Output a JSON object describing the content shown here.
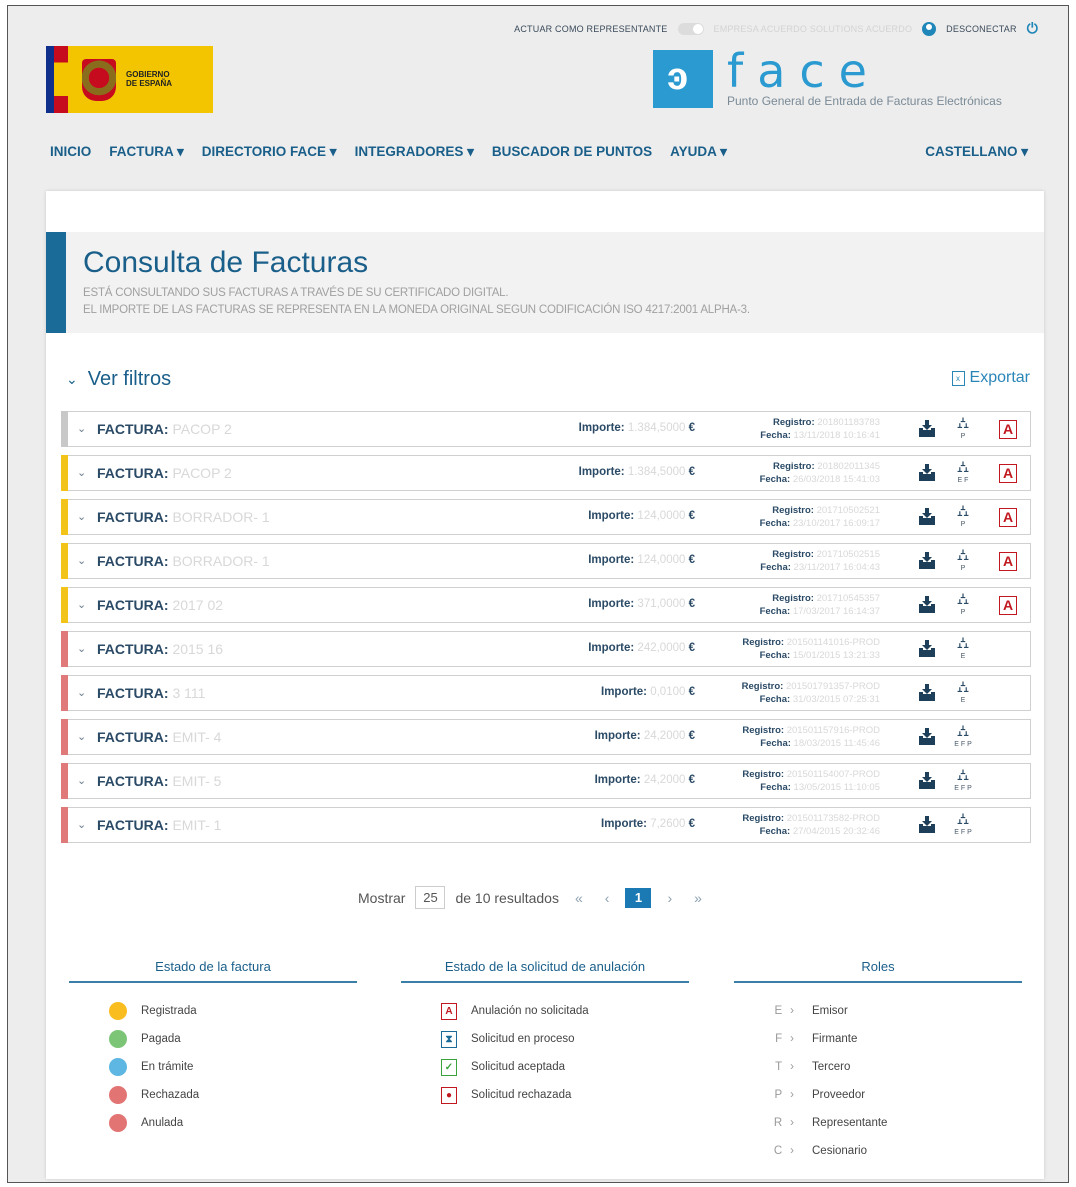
{
  "topbar": {
    "representante_label": "ACTUAR COMO REPRESENTANTE",
    "company_blurred": "EMPRESA ACUERDO SOLUTIONS ACUERDO",
    "disconnect_label": "DESCONECTAR"
  },
  "logos": {
    "gov_text_line1": "GOBIERNO",
    "gov_text_line2": "DE ESPAÑA",
    "face_letters": "face",
    "face_subtitle": "Punto General de Entrada de Facturas Electrónicas"
  },
  "nav": {
    "items": [
      "INICIO",
      "FACTURA ▾",
      "DIRECTORIO FACE ▾",
      "INTEGRADORES ▾",
      "BUSCADOR DE PUNTOS",
      "AYUDA ▾"
    ],
    "language": "CASTELLANO ▾"
  },
  "page": {
    "title": "Consulta de Facturas",
    "subtitle1": "ESTÁ CONSULTANDO SUS FACTURAS A TRAVÉS DE SU CERTIFICADO DIGITAL.",
    "subtitle2": "EL IMPORTE DE LAS FACTURAS SE REPRESENTA EN LA MONEDA ORIGINAL SEGUN CODIFICACIÓN ISO 4217:2001 ALPHA-3.",
    "filters_label": "Ver filtros",
    "export_label": "Exportar"
  },
  "labels": {
    "factura": "FACTURA:",
    "importe": "Importe:",
    "registro": "Registro:",
    "fecha": "Fecha:",
    "currency": "€"
  },
  "invoices": [
    {
      "numero": "PACOP 2",
      "importe": "1.384,5000",
      "registro": "201801183783",
      "fecha": "13/11/2018 10:16:41",
      "status_color": "#c8c8c8",
      "roles": "P",
      "pdf": true
    },
    {
      "numero": "PACOP 2",
      "importe": "1.384,5000",
      "registro": "201802011345",
      "fecha": "26/03/2018 15:41:03",
      "status_color": "#f2c318",
      "roles": "E F",
      "pdf": true
    },
    {
      "numero": "BORRADOR- 1",
      "importe": "124,0000",
      "registro": "201710502521",
      "fecha": "23/10/2017 16:09:17",
      "status_color": "#f2c318",
      "roles": "P",
      "pdf": true
    },
    {
      "numero": "BORRADOR- 1",
      "importe": "124,0000",
      "registro": "201710502515",
      "fecha": "23/11/2017 16:04:43",
      "status_color": "#f2c318",
      "roles": "P",
      "pdf": true
    },
    {
      "numero": "2017 02",
      "importe": "371,0000",
      "registro": "201710545357",
      "fecha": "17/03/2017 16:14:37",
      "status_color": "#f2c318",
      "roles": "P",
      "pdf": true
    },
    {
      "numero": "2015 16",
      "importe": "242,0000",
      "registro": "201501141016-PROD",
      "fecha": "15/01/2015 13:21:33",
      "status_color": "#e07a7a",
      "roles": "E",
      "pdf": false
    },
    {
      "numero": "3 111",
      "importe": "0,0100",
      "registro": "201501791357-PROD",
      "fecha": "31/03/2015 07:25:31",
      "status_color": "#e07a7a",
      "roles": "E",
      "pdf": false
    },
    {
      "numero": "EMIT- 4",
      "importe": "24,2000",
      "registro": "201501157916-PROD",
      "fecha": "18/03/2015 11:45:46",
      "status_color": "#e07a7a",
      "roles": "E F P",
      "pdf": false
    },
    {
      "numero": "EMIT- 5",
      "importe": "24,2000",
      "registro": "201501154007-PROD",
      "fecha": "13/05/2015 11:10:05",
      "status_color": "#e07a7a",
      "roles": "E F P",
      "pdf": false
    },
    {
      "numero": "EMIT- 1",
      "importe": "7,2600",
      "registro": "201501173582-PROD",
      "fecha": "27/04/2015 20:32:46",
      "status_color": "#e07a7a",
      "roles": "E F P",
      "pdf": false
    }
  ],
  "pagination": {
    "mostrar_label": "Mostrar",
    "page_size": "25",
    "results_label": "de 10 resultados",
    "current_page": "1"
  },
  "legend": {
    "estado_title": "Estado de la factura",
    "estados": [
      {
        "label": "Registrada",
        "color": "#f9bd1f"
      },
      {
        "label": "Pagada",
        "color": "#7cc576"
      },
      {
        "label": "En trámite",
        "color": "#5db7e2"
      },
      {
        "label": "Rechazada",
        "color": "#e27474"
      },
      {
        "label": "Anulada",
        "color": "#e27474"
      }
    ],
    "anulacion_title": "Estado de la solicitud de anulación",
    "anulaciones": [
      {
        "label": "Anulación no solicitada",
        "glyph": "A",
        "color": "#c0181e"
      },
      {
        "label": "Solicitud en proceso",
        "glyph": "⧗",
        "color": "#1b6b98"
      },
      {
        "label": "Solicitud aceptada",
        "glyph": "✓",
        "color": "#3aa23a"
      },
      {
        "label": "Solicitud rechazada",
        "glyph": "●",
        "color": "#c0181e"
      }
    ],
    "roles_title": "Roles",
    "roles": [
      {
        "code": "E",
        "label": "Emisor"
      },
      {
        "code": "F",
        "label": "Firmante"
      },
      {
        "code": "T",
        "label": "Tercero"
      },
      {
        "code": "P",
        "label": "Proveedor"
      },
      {
        "code": "R",
        "label": "Representante"
      },
      {
        "code": "C",
        "label": "Cesionario"
      }
    ]
  },
  "icons": {
    "download": "download-tray-icon",
    "org": "org-chart-icon",
    "pdf": "pdf-anulacion-icon",
    "user": "user-icon",
    "power": "power-icon",
    "export": "export-file-icon"
  }
}
